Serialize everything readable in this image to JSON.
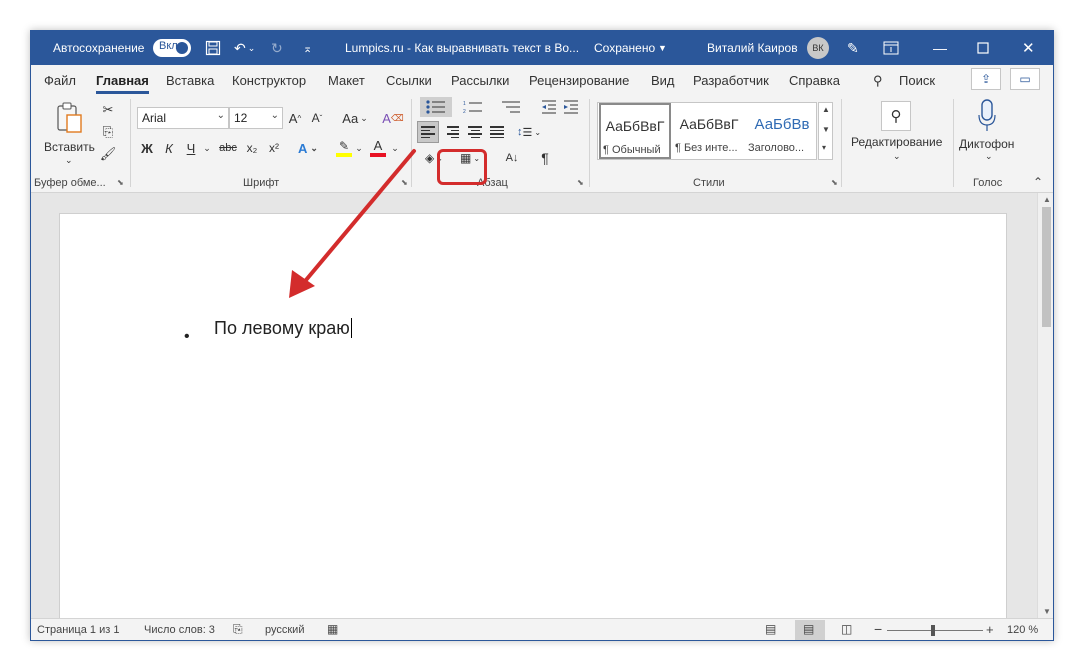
{
  "titlebar": {
    "autosave_label": "Автосохранение",
    "autosave_state": "Вкл.",
    "document_title": "Lumpics.ru - Как выравнивать текст в Во...",
    "save_status": "Сохранено",
    "user_name": "Виталий Каиров",
    "user_initials": "ВК",
    "icons": [
      "save-icon",
      "undo-icon",
      "redo-icon",
      "customize-icon",
      "pen-icon",
      "ribbon-display-icon",
      "minimize-icon",
      "maximize-icon",
      "close-icon"
    ],
    "accent_color": "#2b579a"
  },
  "menu": {
    "tabs": [
      "Файл",
      "Главная",
      "Вставка",
      "Конструктор",
      "Макет",
      "Ссылки",
      "Рассылки",
      "Рецензирование",
      "Вид",
      "Разработчик",
      "Справка"
    ],
    "active_tab": "Главная",
    "search_label": "Поиск"
  },
  "ribbon": {
    "clipboard": {
      "paste_label": "Вставить",
      "group_label": "Буфер обме..."
    },
    "font": {
      "font_name": "Arial",
      "font_size": "12",
      "case_label": "Аа",
      "bold": "Ж",
      "italic": "К",
      "underline": "Ч",
      "strikethrough": "abc",
      "subscript": "x₂",
      "superscript": "x²",
      "group_label": "Шрифт",
      "highlight_color": "#ffff00",
      "font_color": "#e81123"
    },
    "paragraph": {
      "group_label": "Абзац",
      "active_alignment": "left"
    },
    "styles": {
      "items": [
        {
          "sample": "АаБбВвГ",
          "name": "¶ Обычный"
        },
        {
          "sample": "АаБбВвГ",
          "name": "¶ Без инте..."
        },
        {
          "sample": "АаБбВв",
          "name": "Заголово..."
        }
      ],
      "group_label": "Стили"
    },
    "editing": {
      "label": "Редактирование"
    },
    "voice": {
      "label": "Диктофон",
      "group_label": "Голос"
    }
  },
  "document": {
    "paragraph_text": "По левому краю",
    "bullet": "•"
  },
  "statusbar": {
    "page": "Страница 1 из 1",
    "word_count": "Число слов: 3",
    "language": "русский",
    "zoom_level": "120 %"
  },
  "annotation": {
    "highlight_color": "#d32c2c"
  }
}
